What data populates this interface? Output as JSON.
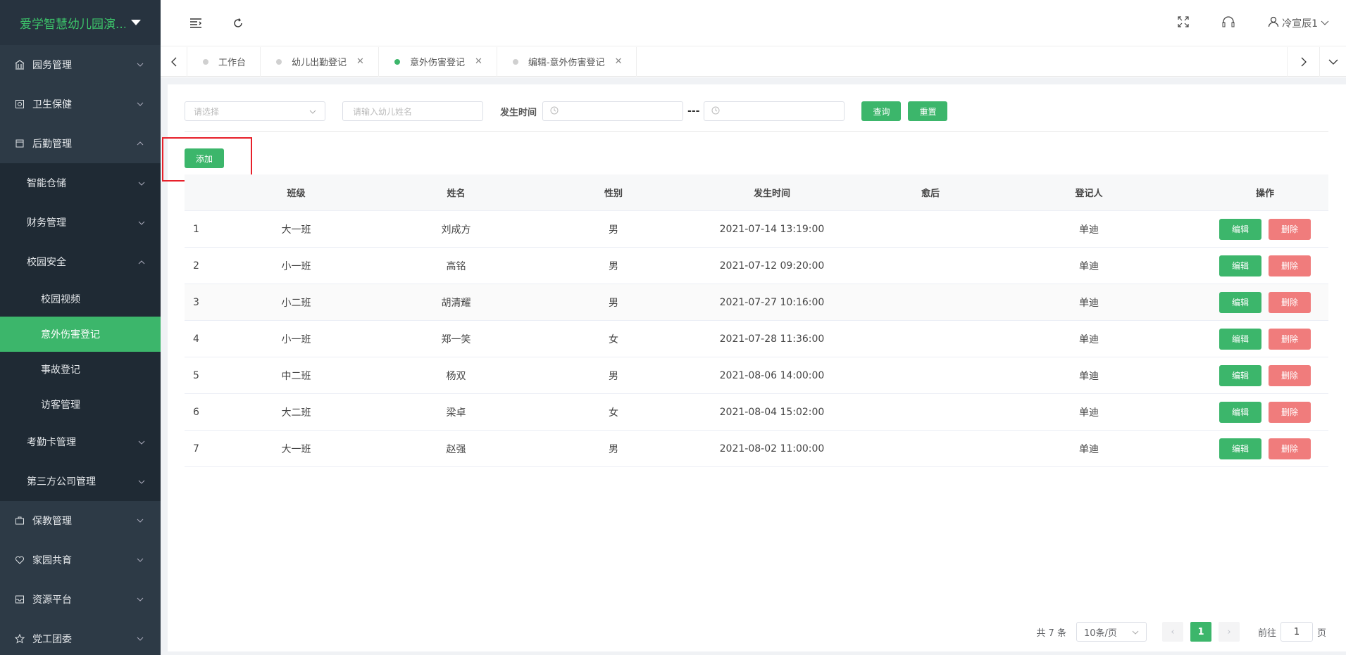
{
  "app": {
    "title": "爱学智慧幼儿园演..."
  },
  "sidebar": {
    "items": [
      {
        "label": "园务管理",
        "icon": "bank-icon"
      },
      {
        "label": "卫生保健",
        "icon": "medical-icon"
      },
      {
        "label": "后勤管理",
        "icon": "box-icon"
      }
    ],
    "logistics_sub": [
      {
        "label": "智能仓储"
      },
      {
        "label": "财务管理"
      },
      {
        "label": "校园安全"
      }
    ],
    "safety_sub": [
      {
        "label": "校园视频"
      },
      {
        "label": "意外伤害登记"
      },
      {
        "label": "事故登记"
      },
      {
        "label": "访客管理"
      }
    ],
    "logistics_sub2": [
      {
        "label": "考勤卡管理"
      },
      {
        "label": "第三方公司管理"
      }
    ],
    "items2": [
      {
        "label": "保教管理",
        "icon": "briefcase-icon"
      },
      {
        "label": "家园共育",
        "icon": "heart-icon"
      },
      {
        "label": "资源平台",
        "icon": "inbox-icon"
      },
      {
        "label": "党工团委",
        "icon": "star-icon"
      }
    ]
  },
  "header": {
    "user": "冷宣辰1"
  },
  "tabs": [
    {
      "label": "工作台",
      "closable": false,
      "active": false
    },
    {
      "label": "幼儿出勤登记",
      "closable": true,
      "active": false
    },
    {
      "label": "意外伤害登记",
      "closable": true,
      "active": true
    },
    {
      "label": "编辑-意外伤害登记",
      "closable": true,
      "active": false
    }
  ],
  "filter": {
    "select_placeholder": "请选择",
    "name_placeholder": "请输入幼儿姓名",
    "time_label": "发生时间",
    "date_sep": "---",
    "query": "查询",
    "reset": "重置"
  },
  "add_label": "添加",
  "table": {
    "headers": {
      "class": "班级",
      "name": "姓名",
      "sex": "性别",
      "time": "发生时间",
      "after": "愈后",
      "reg": "登记人",
      "op": "操作"
    },
    "edit": "编辑",
    "delete": "删除",
    "rows": [
      {
        "idx": "1",
        "class": "大一班",
        "name": "刘成方",
        "sex": "男",
        "time": "2021-07-14 13:19:00",
        "after": "",
        "reg": "单迪"
      },
      {
        "idx": "2",
        "class": "小一班",
        "name": "高铭",
        "sex": "男",
        "time": "2021-07-12 09:20:00",
        "after": "",
        "reg": "单迪"
      },
      {
        "idx": "3",
        "class": "小二班",
        "name": "胡清耀",
        "sex": "男",
        "time": "2021-07-27 10:16:00",
        "after": "",
        "reg": "单迪"
      },
      {
        "idx": "4",
        "class": "小一班",
        "name": "郑一笑",
        "sex": "女",
        "time": "2021-07-28 11:36:00",
        "after": "",
        "reg": "单迪"
      },
      {
        "idx": "5",
        "class": "中二班",
        "name": "杨双",
        "sex": "男",
        "time": "2021-08-06 14:00:00",
        "after": "",
        "reg": "单迪"
      },
      {
        "idx": "6",
        "class": "大二班",
        "name": "梁卓",
        "sex": "女",
        "time": "2021-08-04 15:02:00",
        "after": "",
        "reg": "单迪"
      },
      {
        "idx": "7",
        "class": "大一班",
        "name": "赵强",
        "sex": "男",
        "time": "2021-08-02 11:00:00",
        "after": "",
        "reg": "单迪"
      }
    ]
  },
  "pager": {
    "total": "共 7 条",
    "size": "10条/页",
    "page": "1",
    "goto": "前往",
    "goto_value": "1",
    "page_unit": "页"
  },
  "colors": {
    "accent": "#3cb66b",
    "danger": "#f07c7c",
    "sidebar": "#2d3a46",
    "highlight": "#e7202a"
  }
}
